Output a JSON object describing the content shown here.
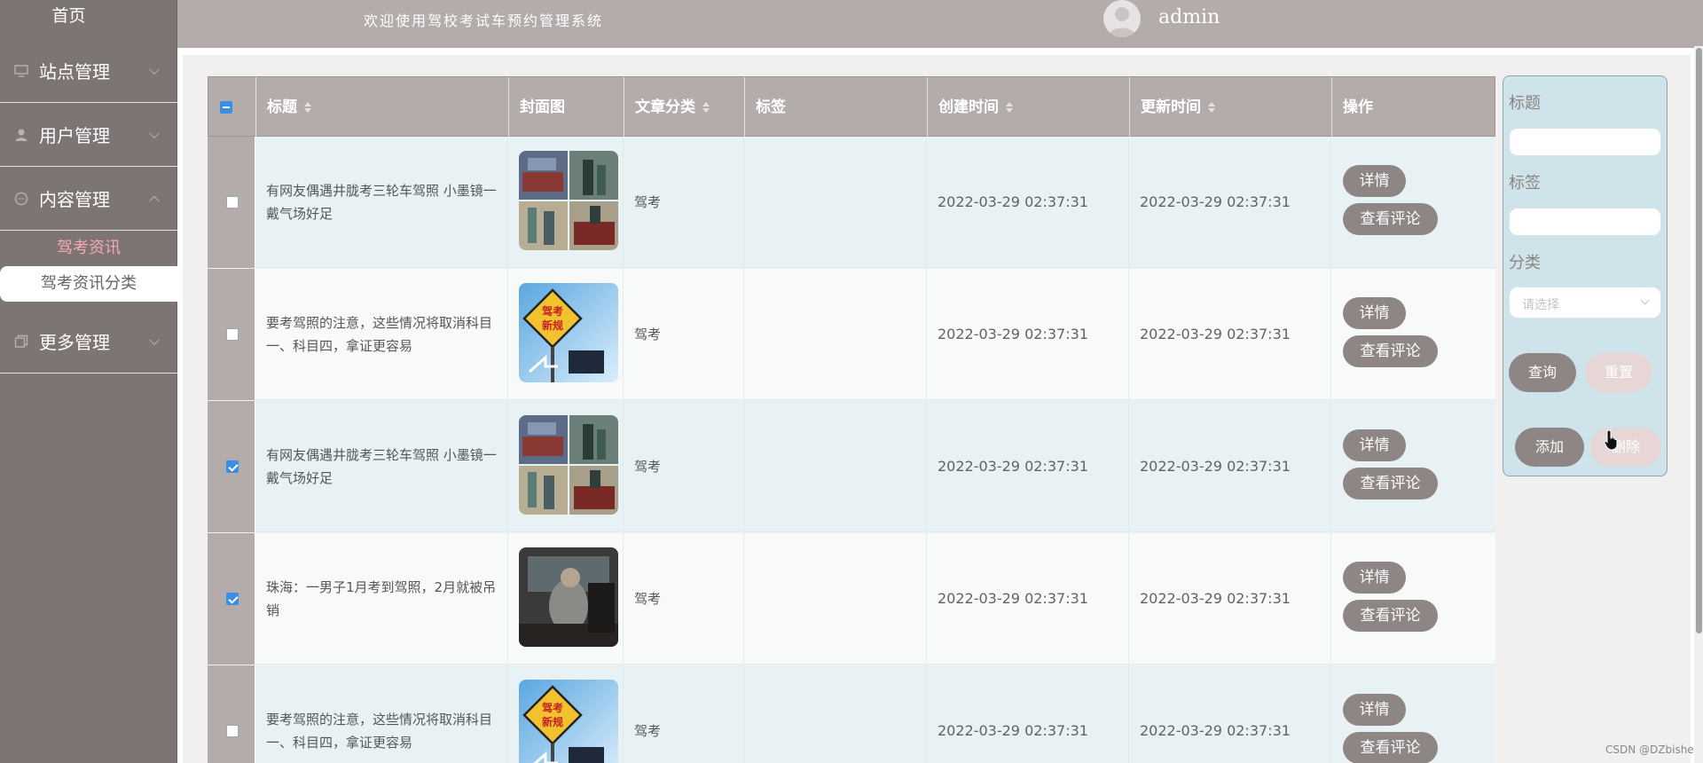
{
  "sidebar": {
    "home": "首页",
    "menus": [
      {
        "label": "站点管理",
        "icon": "monitor-icon"
      },
      {
        "label": "用户管理",
        "icon": "user-icon"
      },
      {
        "label": "内容管理",
        "icon": "chat-icon"
      },
      {
        "label": "更多管理",
        "icon": "copy-icon"
      }
    ],
    "submenu": [
      "驾考资讯",
      "驾考资讯分类"
    ]
  },
  "header": {
    "system_title": "欢迎使用驾校考试车预约管理系统",
    "username": "admin"
  },
  "table": {
    "headers": [
      "标题",
      "封面图",
      "文章分类",
      "标签",
      "创建时间",
      "更新时间",
      "操作"
    ],
    "rows": [
      {
        "title": "有网友偶遇井胧考三轮车驾照 小墨镜一戴气场好足",
        "category": "驾考",
        "tag": "",
        "created": "2022-03-29 02:37:31",
        "updated": "2022-03-29 02:37:31",
        "checked": false,
        "thumb": "collage"
      },
      {
        "title": "要考驾照的注意，这些情况将取消科目一、科目四，拿证更容易",
        "category": "驾考",
        "tag": "",
        "created": "2022-03-29 02:37:31",
        "updated": "2022-03-29 02:37:31",
        "checked": false,
        "thumb": "sign"
      },
      {
        "title": "有网友偶遇井胧考三轮车驾照 小墨镜一戴气场好足",
        "category": "驾考",
        "tag": "",
        "created": "2022-03-29 02:37:31",
        "updated": "2022-03-29 02:37:31",
        "checked": true,
        "thumb": "collage"
      },
      {
        "title": "珠海：一男子1月考到驾照，2月就被吊销",
        "category": "驾考",
        "tag": "",
        "created": "2022-03-29 02:37:31",
        "updated": "2022-03-29 02:37:31",
        "checked": true,
        "thumb": "car"
      },
      {
        "title": "要考驾照的注意，这些情况将取消科目一、科目四，拿证更容易",
        "category": "驾考",
        "tag": "",
        "created": "2022-03-29 02:37:31",
        "updated": "2022-03-29 02:37:31",
        "checked": false,
        "thumb": "sign"
      }
    ],
    "btn_detail": "详情",
    "btn_comments": "查看评论",
    "sign_text_1": "驾考",
    "sign_text_2": "新规"
  },
  "search": {
    "label_title": "标题",
    "label_tag": "标签",
    "label_category": "分类",
    "category_placeholder": "请选择",
    "btn_query": "查询",
    "btn_reset": "重置",
    "btn_add": "添加",
    "btn_delete": "删除"
  },
  "watermark": "CSDN @DZbishe",
  "colors": {
    "sidebar_bg": "#7c7574",
    "header_bg": "#b4acab",
    "button_bg": "#8e8685",
    "active_submenu": "#f6a8b3",
    "checkbox_blue": "#3a8ee6"
  }
}
